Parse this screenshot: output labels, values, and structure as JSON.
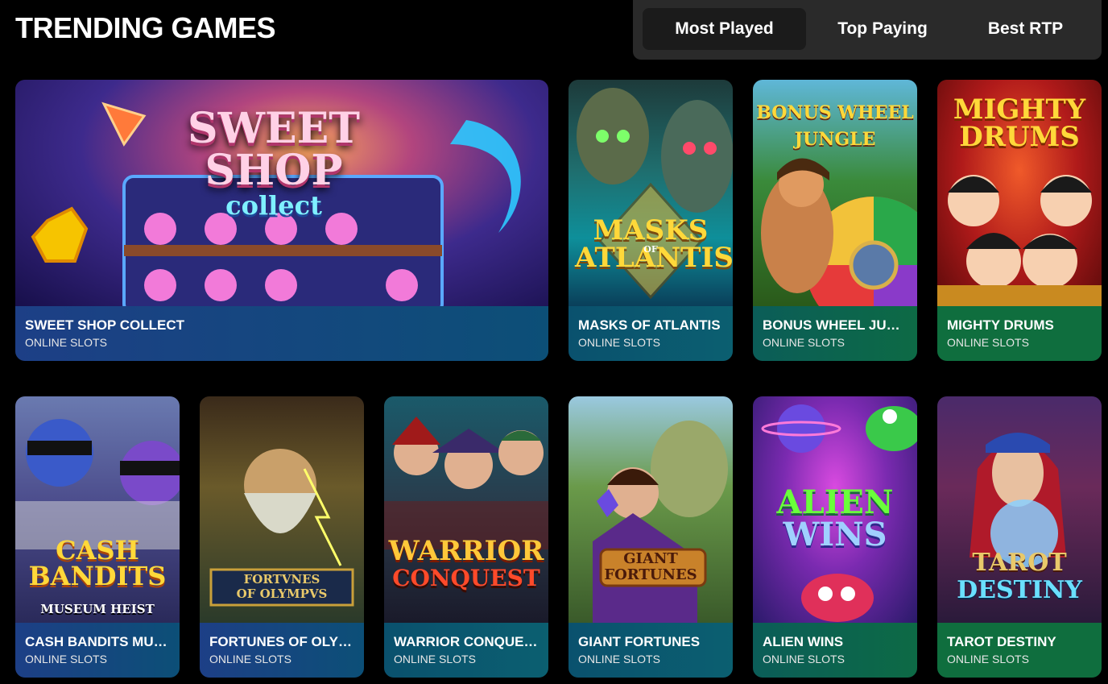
{
  "header": {
    "title": "TRENDING GAMES",
    "tabs": [
      {
        "label": "Most Played",
        "active": true
      },
      {
        "label": "Top Paying",
        "active": false
      },
      {
        "label": "Best RTP",
        "active": false
      }
    ]
  },
  "games": [
    {
      "name": "SWEET SHOP COLLECT",
      "category": "ONLINE SLOTS",
      "art_text": "SWEET SHOP",
      "art_sub": "collect"
    },
    {
      "name": "MASKS OF ATLANTIS",
      "category": "ONLINE SLOTS",
      "art_text": "MASKS ATLANTIS",
      "art_sub": "OF"
    },
    {
      "name": "BONUS WHEEL JUN...",
      "category": "ONLINE SLOTS",
      "art_text": "BONUS WHEEL",
      "art_sub": "JUNGLE"
    },
    {
      "name": "MIGHTY DRUMS",
      "category": "ONLINE SLOTS",
      "art_text": "MIGHTY",
      "art_sub": "DRUMS"
    },
    {
      "name": "CASH BANDITS MUS...",
      "category": "ONLINE SLOTS",
      "art_text": "CASH BANDITS",
      "art_sub": "MUSEUM HEIST"
    },
    {
      "name": "FORTUNES OF OLYM...",
      "category": "ONLINE SLOTS",
      "art_text": "FORTVNES",
      "art_sub": "OF OLYMPVS"
    },
    {
      "name": "WARRIOR CONQUEST",
      "category": "ONLINE SLOTS",
      "art_text": "WARRIOR",
      "art_sub": "CONQUEST"
    },
    {
      "name": "GIANT FORTUNES",
      "category": "ONLINE SLOTS",
      "art_text": "GIANT",
      "art_sub": "FORTUNES"
    },
    {
      "name": "ALIEN WINS",
      "category": "ONLINE SLOTS",
      "art_text": "ALIEN",
      "art_sub": "WINS"
    },
    {
      "name": "TAROT DESTINY",
      "category": "ONLINE SLOTS",
      "art_text": "TAROT",
      "art_sub": "DESTINY"
    }
  ]
}
